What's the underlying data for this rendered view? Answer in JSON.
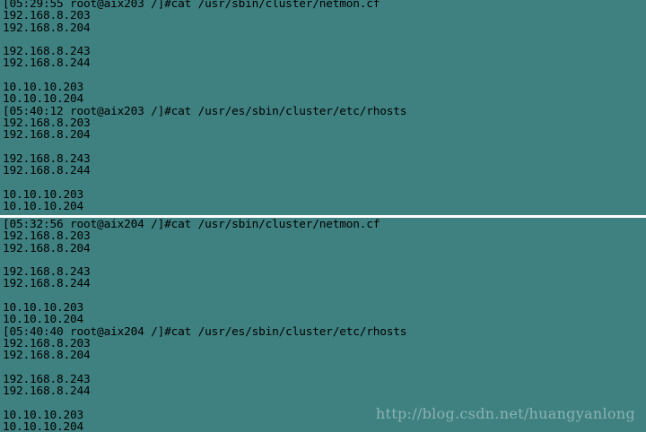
{
  "colors": {
    "terminal_background": "#3f8080",
    "terminal_text": "#000000",
    "divider": "#ffffff"
  },
  "terminal_top": {
    "lines": [
      "[05:29:55 root@aix203 /]#cat /usr/sbin/cluster/netmon.cf",
      "192.168.8.203",
      "192.168.8.204",
      "",
      "192.168.8.243",
      "192.168.8.244",
      "",
      "10.10.10.203",
      "10.10.10.204",
      "[05:40:12 root@aix203 /]#cat /usr/es/sbin/cluster/etc/rhosts",
      "192.168.8.203",
      "192.168.8.204",
      "",
      "192.168.8.243",
      "192.168.8.244",
      "",
      "10.10.10.203",
      "10.10.10.204"
    ]
  },
  "terminal_bottom": {
    "lines": [
      "[05:32:56 root@aix204 /]#cat /usr/sbin/cluster/netmon.cf",
      "192.168.8.203",
      "192.168.8.204",
      "",
      "192.168.8.243",
      "192.168.8.244",
      "",
      "10.10.10.203",
      "10.10.10.204",
      "[05:40:40 root@aix204 /]#cat /usr/es/sbin/cluster/etc/rhosts",
      "192.168.8.203",
      "192.168.8.204",
      "",
      "192.168.8.243",
      "192.168.8.244",
      "",
      "10.10.10.203",
      "10.10.10.204"
    ]
  },
  "watermark": "http://blog.csdn.net/huangyanlong"
}
